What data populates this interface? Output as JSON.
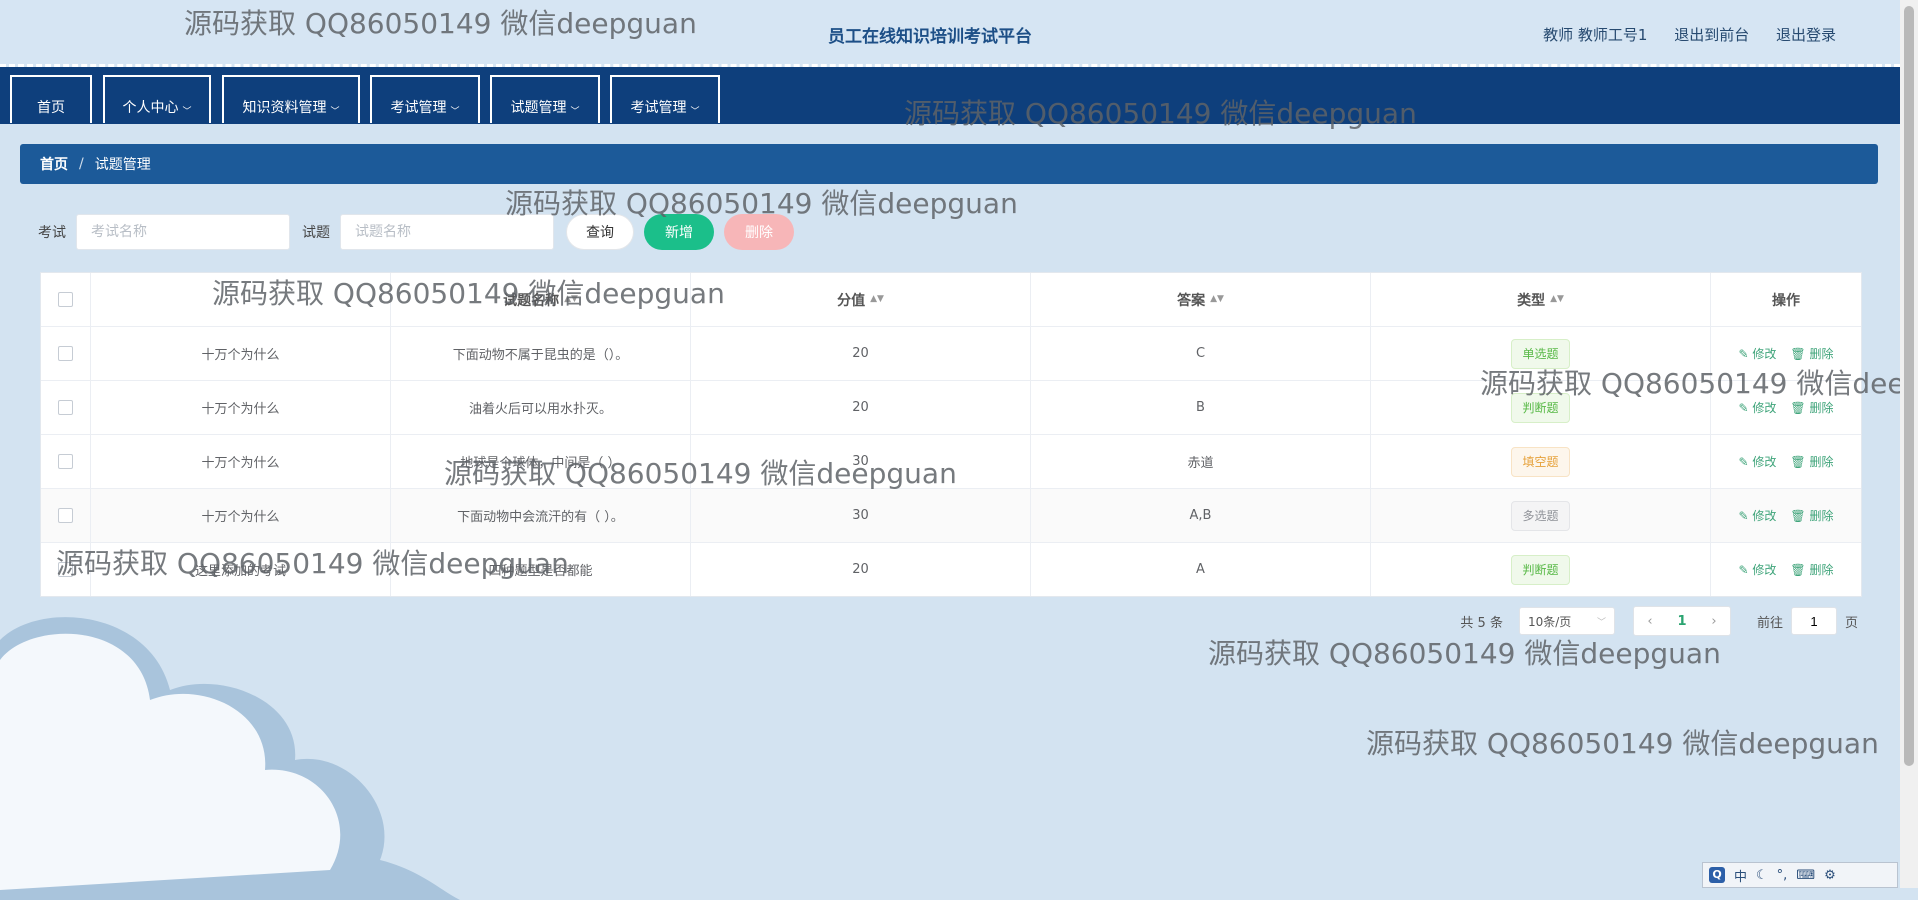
{
  "header": {
    "site_title": "员工在线知识培训考试平台",
    "user_label": "教师 教师工号1",
    "link_front": "退出到前台",
    "link_logout": "退出登录"
  },
  "nav": [
    {
      "label": "首页",
      "dropdown": false
    },
    {
      "label": "个人中心",
      "dropdown": true
    },
    {
      "label": "知识资料管理",
      "dropdown": true
    },
    {
      "label": "考试管理",
      "dropdown": true
    },
    {
      "label": "试题管理",
      "dropdown": true
    },
    {
      "label": "考试管理",
      "dropdown": true
    }
  ],
  "breadcrumb": {
    "home": "首页",
    "separator": "/",
    "current": "试题管理"
  },
  "search": {
    "exam_label": "考试",
    "exam_placeholder": "考试名称",
    "question_label": "试题",
    "question_placeholder": "试题名称",
    "query_button": "查询",
    "add_button": "新增",
    "delete_button": "删除"
  },
  "table": {
    "columns": [
      "",
      "",
      "试题名称",
      "分值",
      "答案",
      "类型",
      "操作"
    ],
    "rows": [
      {
        "exam": "十万个为什么",
        "question": "下面动物不属于昆虫的是（）。",
        "score": "20",
        "answer": "C",
        "type": "单选题",
        "type_kind": "green"
      },
      {
        "exam": "十万个为什么",
        "question": "油着火后可以用水扑灭。",
        "score": "20",
        "answer": "B",
        "type": "判断题",
        "type_kind": "green"
      },
      {
        "exam": "十万个为什么",
        "question": "地球是个球体，中间是（  ）",
        "score": "30",
        "answer": "赤道",
        "type": "填空题",
        "type_kind": "orange"
      },
      {
        "exam": "十万个为什么",
        "question": "下面动物中会流汗的有（  ）。",
        "score": "30",
        "answer": "A,B",
        "type": "多选题",
        "type_kind": "gray"
      },
      {
        "exam": "这里添加的考试",
        "question": "四种题型是否都能",
        "score": "20",
        "answer": "A",
        "type": "判断题",
        "type_kind": "green"
      }
    ],
    "edit_label": "修改",
    "delete_label": "删除"
  },
  "pager": {
    "total_text": "共 5 条",
    "page_size": "10条/页",
    "current_page": "1",
    "goto_label": "前往",
    "goto_value": "1",
    "page_suffix": "页"
  },
  "watermark": "源码获取 QQ86050149 微信deepguan",
  "ime": {
    "mode": "中"
  },
  "colors": {
    "nav_bg": "#0e3f7c",
    "crumb_bg": "#1c5a99",
    "accent_green": "#1bbf8a",
    "delete_pink": "#f7b6b8"
  }
}
